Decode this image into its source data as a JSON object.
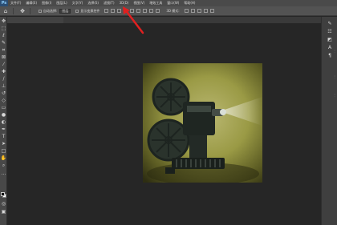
{
  "menu": {
    "logo": "Ps",
    "items": [
      "文件(F)",
      "编辑(E)",
      "图像(I)",
      "图层(L)",
      "文字(Y)",
      "选择(S)",
      "滤镜(T)",
      "3D(D)",
      "视图(V)",
      "增效工具",
      "窗口(W)",
      "帮助(H)"
    ]
  },
  "options": {
    "auto_select_label": "自动选择:",
    "auto_select_value": "图层",
    "show_transform_label": "显示变换控件",
    "mode_3d": "3D 模式:"
  },
  "document": {
    "tab_title": ""
  },
  "colors": {
    "menubar": "#4a4a4a",
    "workspace": "#262626",
    "arrow": "#e02020"
  }
}
